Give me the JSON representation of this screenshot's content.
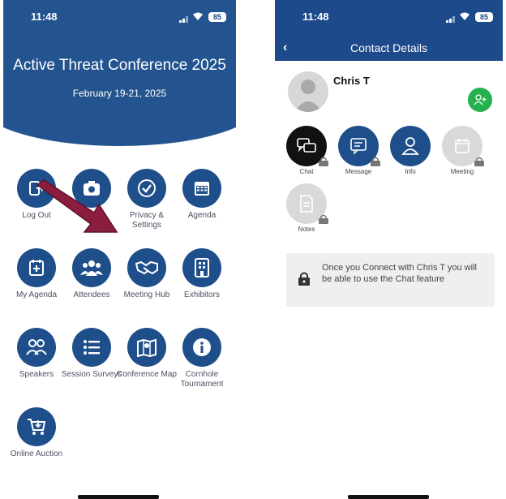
{
  "left": {
    "status": {
      "time": "11:48",
      "battery": "85"
    },
    "header": {
      "title": "Active Threat Conference 2025",
      "date": "February 19-21, 2025"
    },
    "tiles": [
      {
        "label": "Log Out",
        "icon": "logout-icon"
      },
      {
        "label": "",
        "icon": "camera-icon"
      },
      {
        "label": "Privacy & Settings",
        "icon": "check-circle-icon"
      },
      {
        "label": "Agenda",
        "icon": "calendar-icon"
      },
      {
        "label": "My Agenda",
        "icon": "calendar-plus-icon"
      },
      {
        "label": "Attendees",
        "icon": "people-icon"
      },
      {
        "label": "Meeting Hub",
        "icon": "handshake-icon"
      },
      {
        "label": "Exhibitors",
        "icon": "building-icon"
      },
      {
        "label": "Speakers",
        "icon": "speakers-icon"
      },
      {
        "label": "Session Surveys",
        "icon": "list-icon"
      },
      {
        "label": "Conference Map",
        "icon": "map-icon"
      },
      {
        "label": "Cornhole Tournament",
        "icon": "info-icon"
      },
      {
        "label": "Online Auction",
        "icon": "cart-icon"
      }
    ]
  },
  "right": {
    "status": {
      "time": "11:48",
      "battery": "85"
    },
    "nav": {
      "back": "‹",
      "title": "Contact Details"
    },
    "contact": {
      "name": "Chris T"
    },
    "actions": [
      {
        "label": "Chat",
        "icon": "chat-icon"
      },
      {
        "label": "Message",
        "icon": "message-icon"
      },
      {
        "label": "Info",
        "icon": "person-icon"
      },
      {
        "label": "Meeting",
        "icon": "calendar-icon"
      },
      {
        "label": "Notes",
        "icon": "notes-icon"
      }
    ],
    "notice": "Once you Connect with Chris T you will be able to use the Chat feature"
  },
  "colors": {
    "primary": "#1f4f8a",
    "connect": "#24b24f",
    "arrow": "#8b1e3f"
  }
}
